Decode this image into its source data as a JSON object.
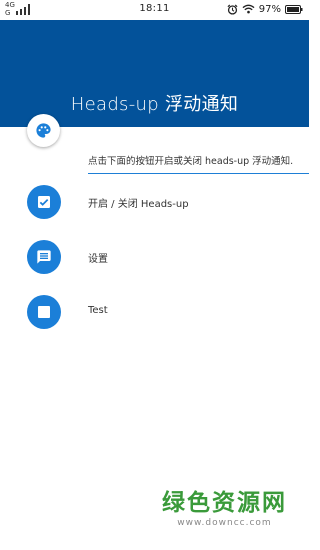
{
  "status_bar": {
    "network_top": "4G",
    "network_bottom": "G",
    "time": "18:11",
    "battery": "97%"
  },
  "header": {
    "title": "Heads-up 浮动通知"
  },
  "description": "点击下面的按钮开启或关闭 heads-up 浮动通知.",
  "items": [
    {
      "label": "开启 / 关闭 Heads-up",
      "icon": "checkbox-icon"
    },
    {
      "label": "设置",
      "icon": "message-icon"
    },
    {
      "label": "Test",
      "icon": "stop-square-icon"
    }
  ],
  "watermark": {
    "main": "绿色资源网",
    "sub": "www.downcc.com"
  },
  "colors": {
    "header": "#03529a",
    "accent": "#1b7fd8"
  }
}
